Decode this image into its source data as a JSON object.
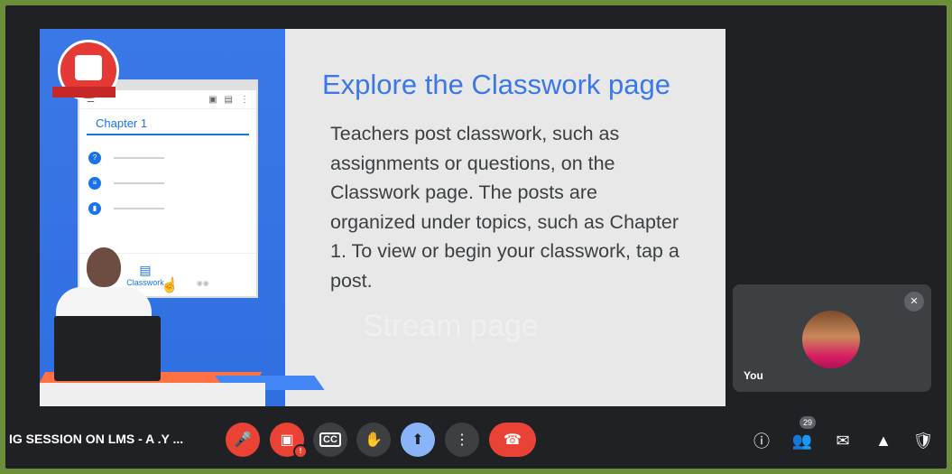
{
  "slide": {
    "title": "Explore the Classwork page",
    "body": "Teachers post classwork, such as assignments or questions, on the Classwork page. The posts are organized under topics, such as Chapter 1. To view or begin your classwork, tap a post.",
    "ghost_text": "Stream page",
    "phone": {
      "chapter": "Chapter 1",
      "nav_classwork": "Classwork"
    }
  },
  "participant": {
    "name": "You"
  },
  "toolbar": {
    "meeting_title": "IG SESSION ON LMS - A .Y ...",
    "participants_count": "29"
  },
  "icons": {
    "mic_off": "mic-off-icon",
    "cam_off": "videocam-off-icon",
    "captions": "closed-caption-icon",
    "raise_hand": "hand-icon",
    "present": "present-screen-icon",
    "more": "more-vert-icon",
    "end_call": "call-end-icon",
    "info": "info-icon",
    "people": "people-icon",
    "chat": "chat-icon",
    "activities": "activities-icon",
    "host_controls": "shield-lock-icon"
  },
  "colors": {
    "accent_red": "#ea4335",
    "accent_blue": "#8ab4f8",
    "slide_title": "#3b78e7"
  }
}
